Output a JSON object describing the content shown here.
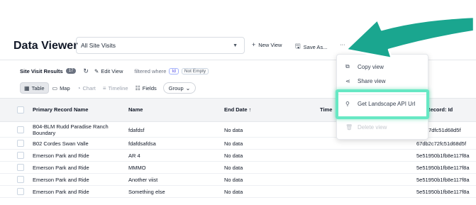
{
  "header": {
    "title": "Data Viewer",
    "view_select": "All Site Visits",
    "new_view_label": "New View",
    "save_as_label": "Save As...",
    "more_label": "···"
  },
  "results": {
    "title": "Site Visit Results",
    "count": "17",
    "edit_view_label": "Edit View",
    "filtered_label": "filtered where",
    "filter_field": "Id",
    "filter_op": "Not Empty"
  },
  "tabs": [
    {
      "label": "Table"
    },
    {
      "label": "Map"
    },
    {
      "label": "Chart"
    },
    {
      "label": "Timeline"
    },
    {
      "label": "Fields"
    },
    {
      "label": "Group"
    }
  ],
  "table": {
    "columns": [
      "Primary Record Name",
      "Name",
      "End Date ↑",
      "Time",
      "ry Record: Id"
    ],
    "rows": [
      {
        "primary": "B04-BLM Rudd Paradise Ranch",
        "primary2": "Boundary",
        "name": "fdafdsf",
        "end_date": "No data",
        "record_id": "d2c7dfc51d68d5f"
      },
      {
        "primary": "B02 Cordes Swan Valle",
        "name": "fdafdsafdsa",
        "end_date": "No data",
        "record_id": "67db2c72fc51d68d5f"
      },
      {
        "primary": "Emerson Park and Ride",
        "name": "AR 4",
        "end_date": "No data",
        "record_id": "5e51950b1fb8e117f8a"
      },
      {
        "primary": "Emerson Park and Ride",
        "name": "MMMO",
        "end_date": "No data",
        "record_id": "5e51950b1fb8e117f8a"
      },
      {
        "primary": "Emerson Park and Ride",
        "name": "Another viist",
        "end_date": "No data",
        "record_id": "5e51950b1fb8e117f8a"
      },
      {
        "primary": "Emerson Park and Ride",
        "name": "Something else",
        "end_date": "No data",
        "record_id": "5e51950b1fb8e117f8a"
      }
    ]
  },
  "menu": {
    "items": [
      {
        "label": "Copy view",
        "icon": "copy-icon"
      },
      {
        "label": "Share view",
        "icon": "share-icon"
      },
      {
        "label": "Get Landscape API Url",
        "icon": "api-icon"
      },
      {
        "label": "Delete view",
        "icon": "trash-icon"
      }
    ]
  },
  "colors": {
    "highlight": "#67e8c4",
    "arrow": "#1aa68f"
  }
}
